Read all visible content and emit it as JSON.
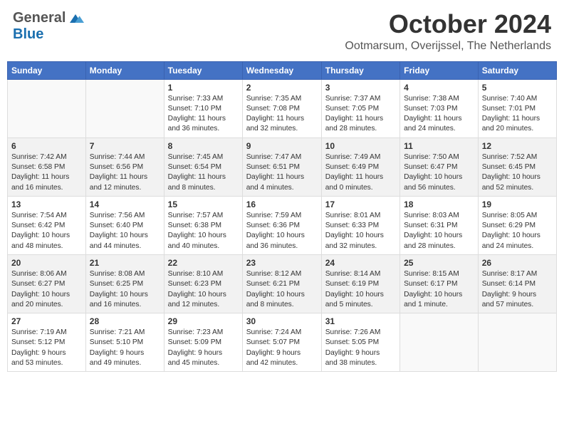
{
  "header": {
    "logo": {
      "general": "General",
      "blue": "Blue"
    },
    "title": "October 2024",
    "location": "Ootmarsum, Overijssel, The Netherlands"
  },
  "days_of_week": [
    "Sunday",
    "Monday",
    "Tuesday",
    "Wednesday",
    "Thursday",
    "Friday",
    "Saturday"
  ],
  "weeks": [
    {
      "days": [
        {
          "num": "",
          "info": ""
        },
        {
          "num": "",
          "info": ""
        },
        {
          "num": "1",
          "info": "Sunrise: 7:33 AM\nSunset: 7:10 PM\nDaylight: 11 hours\nand 36 minutes."
        },
        {
          "num": "2",
          "info": "Sunrise: 7:35 AM\nSunset: 7:08 PM\nDaylight: 11 hours\nand 32 minutes."
        },
        {
          "num": "3",
          "info": "Sunrise: 7:37 AM\nSunset: 7:05 PM\nDaylight: 11 hours\nand 28 minutes."
        },
        {
          "num": "4",
          "info": "Sunrise: 7:38 AM\nSunset: 7:03 PM\nDaylight: 11 hours\nand 24 minutes."
        },
        {
          "num": "5",
          "info": "Sunrise: 7:40 AM\nSunset: 7:01 PM\nDaylight: 11 hours\nand 20 minutes."
        }
      ]
    },
    {
      "days": [
        {
          "num": "6",
          "info": "Sunrise: 7:42 AM\nSunset: 6:58 PM\nDaylight: 11 hours\nand 16 minutes."
        },
        {
          "num": "7",
          "info": "Sunrise: 7:44 AM\nSunset: 6:56 PM\nDaylight: 11 hours\nand 12 minutes."
        },
        {
          "num": "8",
          "info": "Sunrise: 7:45 AM\nSunset: 6:54 PM\nDaylight: 11 hours\nand 8 minutes."
        },
        {
          "num": "9",
          "info": "Sunrise: 7:47 AM\nSunset: 6:51 PM\nDaylight: 11 hours\nand 4 minutes."
        },
        {
          "num": "10",
          "info": "Sunrise: 7:49 AM\nSunset: 6:49 PM\nDaylight: 11 hours\nand 0 minutes."
        },
        {
          "num": "11",
          "info": "Sunrise: 7:50 AM\nSunset: 6:47 PM\nDaylight: 10 hours\nand 56 minutes."
        },
        {
          "num": "12",
          "info": "Sunrise: 7:52 AM\nSunset: 6:45 PM\nDaylight: 10 hours\nand 52 minutes."
        }
      ]
    },
    {
      "days": [
        {
          "num": "13",
          "info": "Sunrise: 7:54 AM\nSunset: 6:42 PM\nDaylight: 10 hours\nand 48 minutes."
        },
        {
          "num": "14",
          "info": "Sunrise: 7:56 AM\nSunset: 6:40 PM\nDaylight: 10 hours\nand 44 minutes."
        },
        {
          "num": "15",
          "info": "Sunrise: 7:57 AM\nSunset: 6:38 PM\nDaylight: 10 hours\nand 40 minutes."
        },
        {
          "num": "16",
          "info": "Sunrise: 7:59 AM\nSunset: 6:36 PM\nDaylight: 10 hours\nand 36 minutes."
        },
        {
          "num": "17",
          "info": "Sunrise: 8:01 AM\nSunset: 6:33 PM\nDaylight: 10 hours\nand 32 minutes."
        },
        {
          "num": "18",
          "info": "Sunrise: 8:03 AM\nSunset: 6:31 PM\nDaylight: 10 hours\nand 28 minutes."
        },
        {
          "num": "19",
          "info": "Sunrise: 8:05 AM\nSunset: 6:29 PM\nDaylight: 10 hours\nand 24 minutes."
        }
      ]
    },
    {
      "days": [
        {
          "num": "20",
          "info": "Sunrise: 8:06 AM\nSunset: 6:27 PM\nDaylight: 10 hours\nand 20 minutes."
        },
        {
          "num": "21",
          "info": "Sunrise: 8:08 AM\nSunset: 6:25 PM\nDaylight: 10 hours\nand 16 minutes."
        },
        {
          "num": "22",
          "info": "Sunrise: 8:10 AM\nSunset: 6:23 PM\nDaylight: 10 hours\nand 12 minutes."
        },
        {
          "num": "23",
          "info": "Sunrise: 8:12 AM\nSunset: 6:21 PM\nDaylight: 10 hours\nand 8 minutes."
        },
        {
          "num": "24",
          "info": "Sunrise: 8:14 AM\nSunset: 6:19 PM\nDaylight: 10 hours\nand 5 minutes."
        },
        {
          "num": "25",
          "info": "Sunrise: 8:15 AM\nSunset: 6:17 PM\nDaylight: 10 hours\nand 1 minute."
        },
        {
          "num": "26",
          "info": "Sunrise: 8:17 AM\nSunset: 6:14 PM\nDaylight: 9 hours\nand 57 minutes."
        }
      ]
    },
    {
      "days": [
        {
          "num": "27",
          "info": "Sunrise: 7:19 AM\nSunset: 5:12 PM\nDaylight: 9 hours\nand 53 minutes."
        },
        {
          "num": "28",
          "info": "Sunrise: 7:21 AM\nSunset: 5:10 PM\nDaylight: 9 hours\nand 49 minutes."
        },
        {
          "num": "29",
          "info": "Sunrise: 7:23 AM\nSunset: 5:09 PM\nDaylight: 9 hours\nand 45 minutes."
        },
        {
          "num": "30",
          "info": "Sunrise: 7:24 AM\nSunset: 5:07 PM\nDaylight: 9 hours\nand 42 minutes."
        },
        {
          "num": "31",
          "info": "Sunrise: 7:26 AM\nSunset: 5:05 PM\nDaylight: 9 hours\nand 38 minutes."
        },
        {
          "num": "",
          "info": ""
        },
        {
          "num": "",
          "info": ""
        }
      ]
    }
  ]
}
